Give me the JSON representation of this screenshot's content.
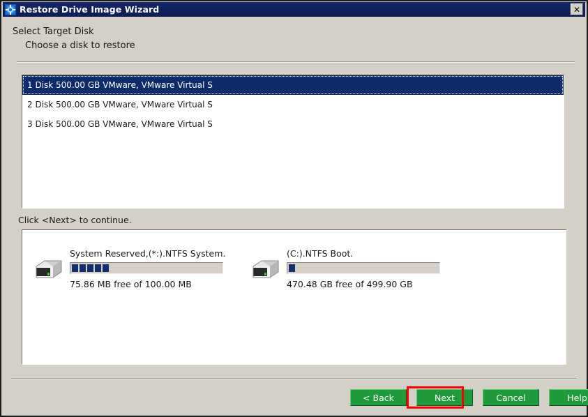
{
  "window": {
    "title": "Restore Drive Image Wizard",
    "title_icon": "restore-circular-arrows-icon",
    "close_label": "✕",
    "colors": {
      "titlebar": "#12225f",
      "dialog_face": "#d4d0c8",
      "selection": "#0d2b6b",
      "button_green": "#1f9b3c",
      "highlight_red": "#ff0000",
      "usage_segment": "#12306e"
    }
  },
  "header": {
    "title": "Select Target Disk",
    "subtitle": "Choose a disk to restore"
  },
  "disk_list": {
    "items": [
      {
        "label": "1 Disk 500.00 GB VMware,  VMware Virtual S",
        "selected": true
      },
      {
        "label": "2 Disk 500.00 GB VMware,  VMware Virtual S",
        "selected": false
      },
      {
        "label": "3 Disk 500.00 GB VMware,  VMware Virtual S",
        "selected": false
      }
    ]
  },
  "hint": {
    "text": "Click <Next> to continue."
  },
  "partitions": [
    {
      "icon": "hard-drive-icon",
      "label": "System Reserved,(*:).NTFS System.",
      "free_text": "75.86 MB free of 100.00 MB",
      "used_segments": 5,
      "free_value": "75.86 MB",
      "total_value": "100.00 MB"
    },
    {
      "icon": "hard-drive-icon",
      "label": "(C:).NTFS Boot.",
      "free_text": "470.48 GB free of 499.90 GB",
      "used_segments": 1,
      "free_value": "470.48 GB",
      "total_value": "499.90 GB"
    }
  ],
  "buttons": [
    {
      "label": "< Back",
      "name": "back-button",
      "highlighted": false
    },
    {
      "label": "Next",
      "name": "next-button",
      "highlighted": true
    },
    {
      "label": "Cancel",
      "name": "cancel-button",
      "highlighted": false
    },
    {
      "label": "Help",
      "name": "help-button",
      "highlighted": false
    }
  ]
}
